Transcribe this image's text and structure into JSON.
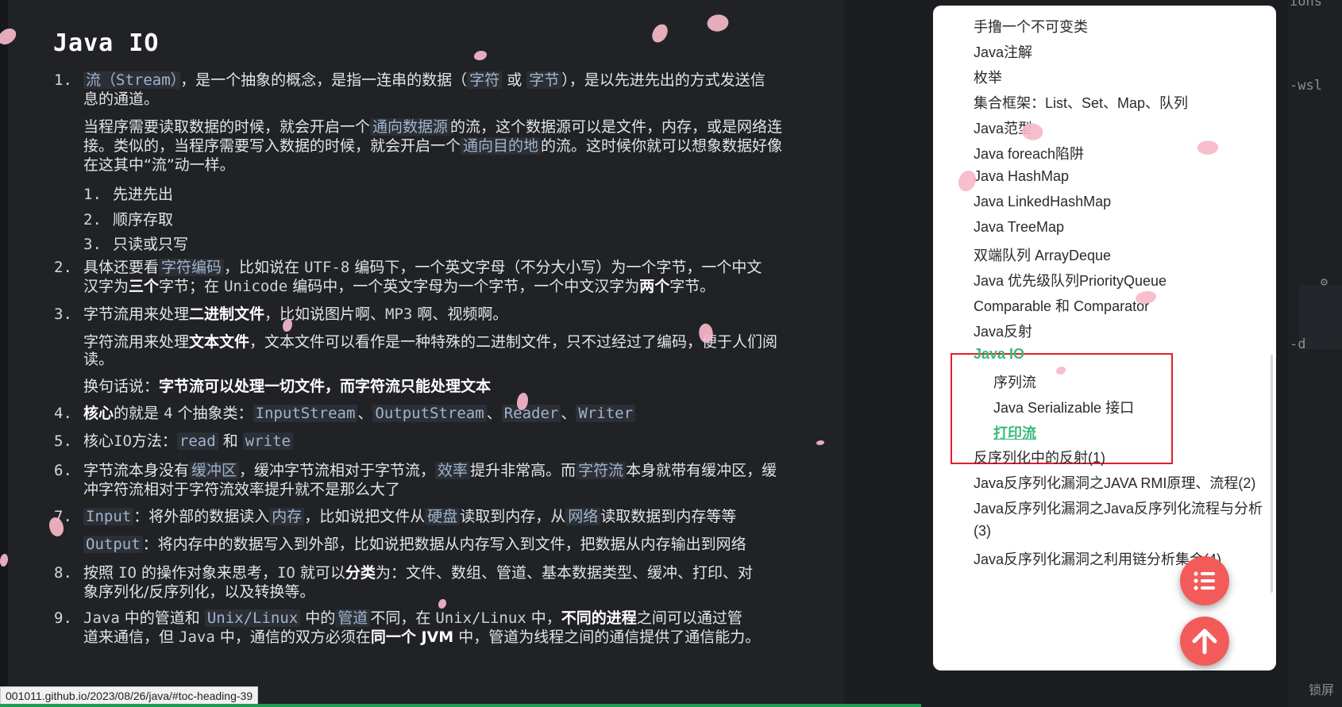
{
  "article": {
    "title": "Java IO",
    "items": [
      {
        "n": "1.",
        "t": "流（Stream），是一个抽象的概念，是指一连串的数据（字符 或 字节），是以先进先出的方式发送信"
      },
      {
        "t": "息的通道。"
      },
      {
        "t": "当程序需要读取数据的时候，就会开启一个 通向数据源 的流，这个数据源可以是文件，内存，或是网络连"
      },
      {
        "t": "接。类似的，当程序需要写入数据的时候，就会开启一个 通向目的地 的流。这时候你就可以想象数据好像"
      },
      {
        "t": "在这其中“流”动一样。"
      }
    ],
    "sublist": [
      "先进先出",
      "顺序存取",
      "只读或只写"
    ],
    "p2a": "具体还要看 字符编码，比如说在 UTF-8 编码下，一个英文字母（不分大小写）为一个字节，一个中文",
    "p2b": "汉字为三个字节；在 Unicode 编码中，一个英文字母为一个字节，一个中文汉字为两个字节。",
    "p3a": "字节流用来处理二进制文件，比如说图片啊、MP3 啊、视频啊。",
    "p3b": "字符流用来处理文本文件，文本文件可以看作是一种特殊的二进制文件，只不过经过了编码，便于人们阅",
    "p3c": "读。",
    "p3d_pre": "换句话说：",
    "p3d_bold": "字节流可以处理一切文件，而字符流只能处理文本",
    "p4": "核心的就是 4 个抽象类：InputStream、OutputStream、Reader、Writer",
    "p5": "核心IO方法：read 和 write",
    "p6a": "字节流本身没有缓冲区，缓冲字节流相对于字节流，效率提升非常高。而字符流本身就带有缓冲区，缓",
    "p6b": "冲字符流相对于字符流效率提升就不是那么大了",
    "p7a": "Input：将外部的数据读入内存，比如说把文件从硬盘读取到内存，从网络读取数据到内存等等",
    "p7b": "Output：将内存中的数据写入到外部，比如说把数据从内存写入到文件，把数据从内存输出到网络",
    "p8a": "按照 IO 的操作对象来思考，IO 就可以分类为：文件、数组、管道、基本数据类型、缓冲、打印、对",
    "p8b": "象序列化/反序列化，以及转换等。",
    "p9a": "Java 中的管道和 Unix/Linux 中的管道不同，在 Unix/Linux 中，不同的进程之间可以通过管",
    "p9b": "道来通信，但 Java 中，通信的双方必须在同一个 JVM 中，管道为线程之间的通信提供了通信能力。"
  },
  "toc": {
    "items": [
      "手撸一个不可变类",
      "Java注解",
      "枚举",
      "集合框架：List、Set、Map、队列",
      "Java范型",
      "Java foreach陷阱",
      "Java HashMap",
      "Java LinkedHashMap",
      "Java TreeMap",
      "双端队列 ArrayDeque",
      "Java 优先级队列PriorityQueue",
      "Comparable 和 Comparator",
      "Java反射"
    ],
    "active": "Java IO",
    "sub": [
      "序列流",
      "Java Serializable 接口"
    ],
    "active_sub": "打印流",
    "after": [
      "反序列化中的反射(1)",
      "Java反序列化漏洞之JAVA RMI原理、流程(2)",
      "Java反序列化漏洞之Java反序列化流程与分析",
      "(3)",
      "Java反序列化漏洞之利用链分析集合(4)"
    ]
  },
  "status_url": "001011.github.io/2023/08/26/java/#toc-heading-39",
  "rightstrip": {
    "t1": "ions",
    "t2": "-wsl",
    "t3": "-d",
    "t4": "锁屏"
  },
  "colors": {
    "accent": "#3bb77e",
    "fab": "#f35b5b",
    "highlight_box": "#e0202a"
  }
}
